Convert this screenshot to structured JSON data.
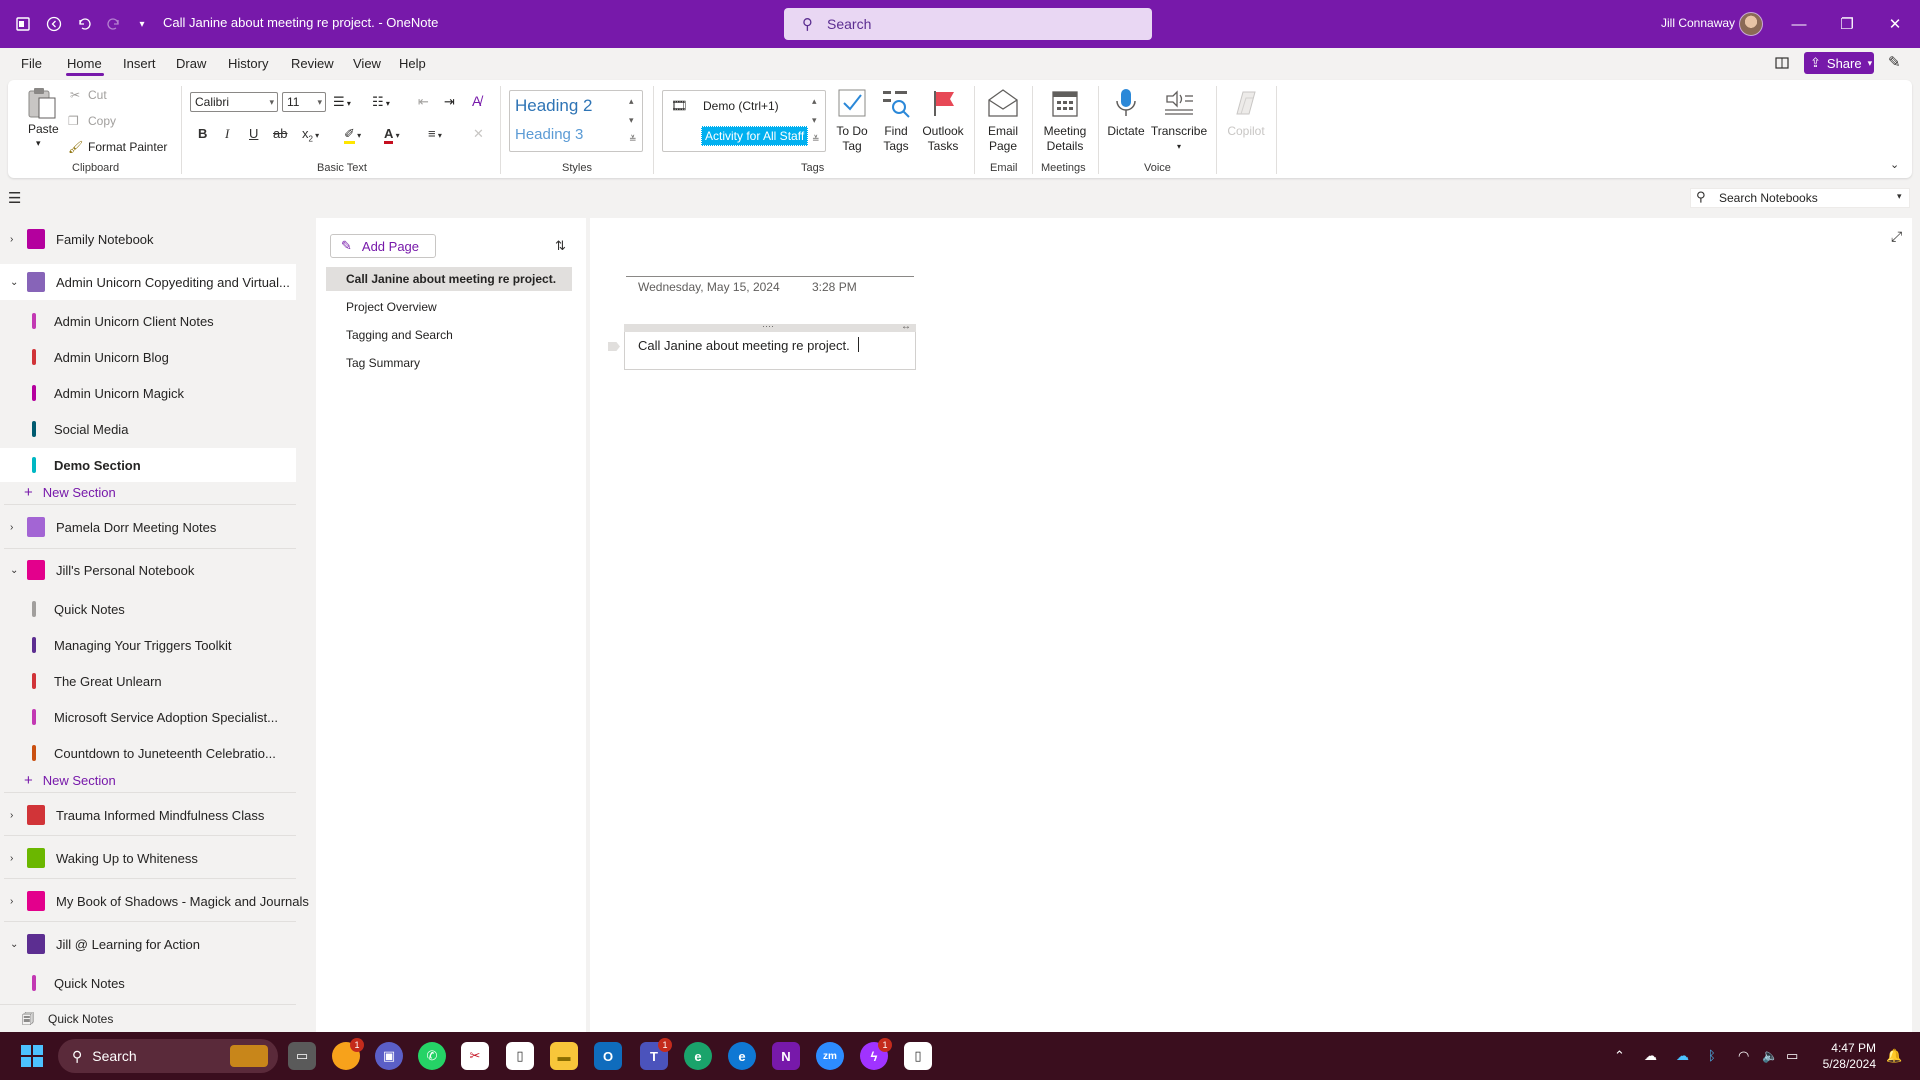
{
  "titlebar": {
    "title": "Call Janine about meeting re project.  -  OneNote",
    "search_placeholder": "Search",
    "user_name": "Jill Connaway"
  },
  "menu": {
    "tabs": [
      "File",
      "Home",
      "Insert",
      "Draw",
      "History",
      "Review",
      "View",
      "Help"
    ],
    "active": "Home",
    "share_label": "Share"
  },
  "ribbon": {
    "clipboard": {
      "paste": "Paste",
      "cut": "Cut",
      "copy": "Copy",
      "format_painter": "Format Painter",
      "group": "Clipboard"
    },
    "basic_text": {
      "font": "Calibri",
      "size": "11",
      "group": "Basic Text"
    },
    "styles": {
      "heading2": "Heading 2",
      "heading3": "Heading 3",
      "group": "Styles"
    },
    "tags": {
      "tag1": "Demo (Ctrl+1)",
      "tag2": "Activity for All Staff",
      "todo": "To Do Tag",
      "todo_l1": "To Do",
      "todo_l2": "Tag",
      "find_l1": "Find",
      "find_l2": "Tags",
      "outlook_l1": "Outlook",
      "outlook_l2": "Tasks",
      "group": "Tags"
    },
    "email": {
      "l1": "Email",
      "l2": "Page",
      "group": "Email"
    },
    "meetings": {
      "l1": "Meeting",
      "l2": "Details",
      "group": "Meetings"
    },
    "voice": {
      "dictate": "Dictate",
      "transcribe": "Transcribe",
      "group": "Voice"
    },
    "copilot": "Copilot"
  },
  "search_notebooks_placeholder": "Search Notebooks",
  "notebooks": [
    {
      "name": "Family Notebook",
      "expanded": false,
      "color": "#b4009e"
    },
    {
      "name": "Admin Unicorn Copyediting and Virtual...",
      "expanded": true,
      "color": "#8764b8",
      "sections": [
        {
          "name": "Admin Unicorn Client Notes",
          "color": "#c239b3"
        },
        {
          "name": "Admin Unicorn Blog",
          "color": "#d13438"
        },
        {
          "name": "Admin Unicorn Magick",
          "color": "#b4009e"
        },
        {
          "name": "Social Media",
          "color": "#005b70"
        },
        {
          "name": "Demo Section",
          "color": "#00b7c3",
          "active": true
        }
      ],
      "new_section": "New Section"
    },
    {
      "name": "Pamela Dorr Meeting Notes",
      "expanded": false,
      "color": "#a365d4"
    },
    {
      "name": "Jill's Personal Notebook",
      "expanded": true,
      "color": "#e3008c",
      "sections": [
        {
          "name": "Quick Notes",
          "color": "#a19f9d"
        },
        {
          "name": "Managing Your Triggers Toolkit",
          "color": "#5c2e91"
        },
        {
          "name": "The Great Unlearn",
          "color": "#d13438"
        },
        {
          "name": "Microsoft Service Adoption Specialist...",
          "color": "#c239b3"
        },
        {
          "name": "Countdown to Juneteenth Celebratio...",
          "color": "#ca5010"
        }
      ],
      "new_section": "New Section"
    },
    {
      "name": "Trauma Informed Mindfulness Class",
      "expanded": false,
      "color": "#d13438"
    },
    {
      "name": "Waking Up to Whiteness",
      "expanded": false,
      "color": "#6bb700"
    },
    {
      "name": "My Book of Shadows - Magick and Journals",
      "expanded": false,
      "color": "#e3008c"
    },
    {
      "name": "Jill @ Learning for Action",
      "expanded": true,
      "color": "#5c2e91",
      "sections": [
        {
          "name": "Quick Notes",
          "color": "#c239b3"
        }
      ]
    }
  ],
  "bottom_quick_notes": "Quick Notes",
  "pages": {
    "add_page": "Add Page",
    "items": [
      {
        "title": "Call Janine about meeting re project.",
        "active": true
      },
      {
        "title": "Project Overview"
      },
      {
        "title": "Tagging and Search"
      },
      {
        "title": "Tag Summary"
      }
    ]
  },
  "page": {
    "date": "Wednesday, May 15, 2024",
    "time": "3:28 PM",
    "note": "Call Janine about meeting re project."
  },
  "taskbar": {
    "search": "Search",
    "time": "4:47 PM",
    "date": "5/28/2024",
    "badges": [
      "1",
      "1",
      "1"
    ]
  }
}
